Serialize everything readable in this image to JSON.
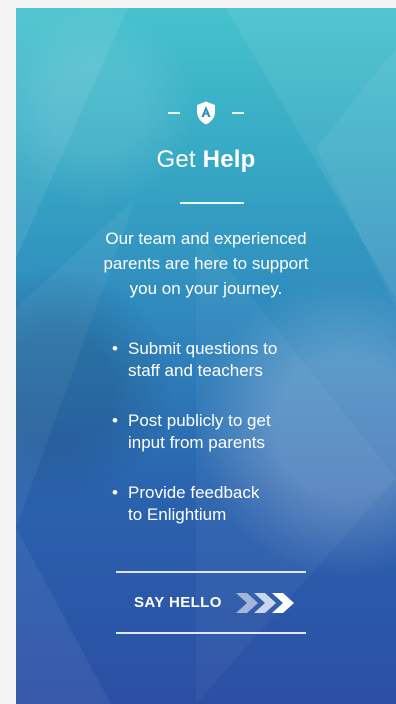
{
  "page": {
    "title_prefix": "Get",
    "title_bold": "Help",
    "intro": "Our team and experienced parents are here to support you on your journey.",
    "bullets": [
      {
        "line1": "Submit questions to",
        "line2": "staff and teachers"
      },
      {
        "line1": "Post publicly to get",
        "line2": "input from parents"
      },
      {
        "line1": "Provide feedback",
        "line2": "to Enlightium"
      }
    ],
    "cta_label": "SAY HELLO"
  },
  "colors": {
    "top_teal": "#46c2cd",
    "bottom_blue": "#2c4fa4",
    "text": "#ffffff"
  },
  "icons": {
    "logo": "shield-a-logo-icon",
    "cta": "chevron-arrows-icon"
  }
}
